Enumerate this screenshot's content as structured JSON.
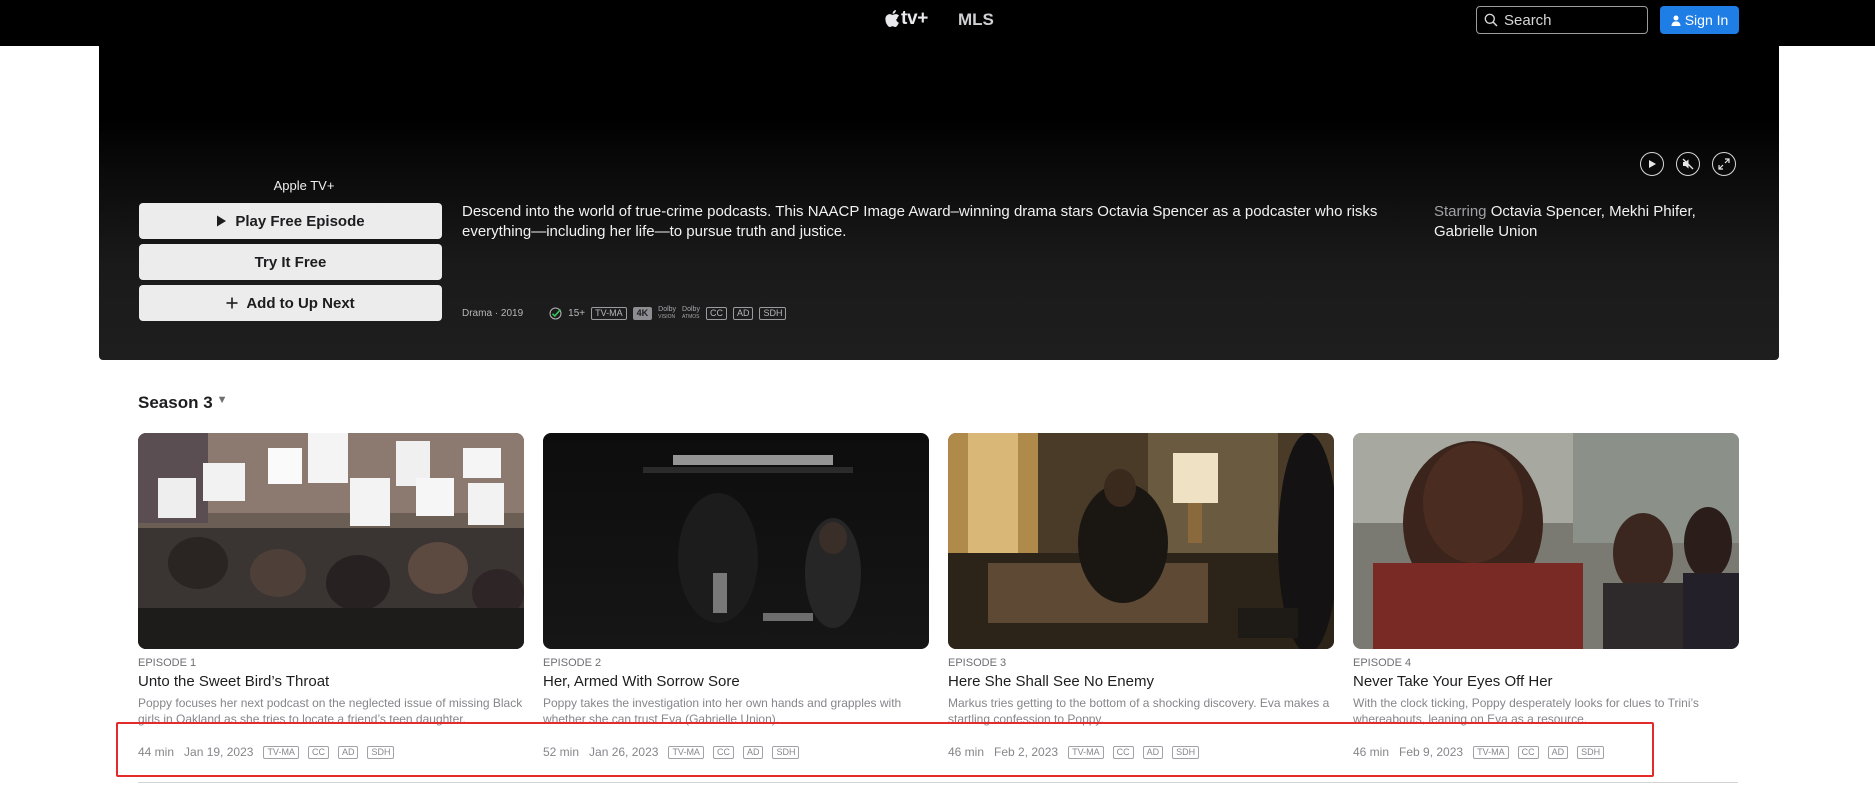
{
  "nav": {
    "brand": "tv+",
    "mls": "MLS",
    "search_placeholder": "Search",
    "signin_label": "Sign In"
  },
  "hero": {
    "provider": "Apple TV+",
    "play_label": "Play Free Episode",
    "try_label": "Try It Free",
    "upnext_label": "Add to Up Next",
    "description": "Descend into the world of true-crime podcasts. This NAACP Image Award–winning drama stars Octavia Spencer as a podcaster who risks everything—including her life—to pursue truth and justice.",
    "starring_label": "Starring",
    "starring_names": "Octavia Spencer, Mekhi Phifer, Gabrielle Union",
    "genre_year": "Drama · 2019",
    "age_rating": "15+",
    "badges": [
      "TV-MA",
      "4K",
      "CC",
      "AD",
      "SDH"
    ],
    "dolby_vision": [
      "Dolby",
      "VISION"
    ],
    "dolby_atmos": [
      "Dolby",
      "ATMOS"
    ],
    "controls": [
      "play-icon",
      "mute-icon",
      "fullscreen-icon"
    ]
  },
  "season": {
    "label": "Season 3"
  },
  "episodes": [
    {
      "num": "EPISODE 1",
      "title": "Unto the Sweet Bird’s Throat",
      "desc": "Poppy focuses her next podcast on the neglected issue of missing Black girls in Oakland as she tries to locate a friend’s teen daughter.",
      "duration": "44 min",
      "date": "Jan 19, 2023",
      "badges": [
        "TV-MA",
        "CC",
        "AD",
        "SDH"
      ]
    },
    {
      "num": "EPISODE 2",
      "title": "Her, Armed With Sorrow Sore",
      "desc": "Poppy takes the investigation into her own hands and grapples with whether she can trust Eva (Gabrielle Union).",
      "duration": "52 min",
      "date": "Jan 26, 2023",
      "badges": [
        "TV-MA",
        "CC",
        "AD",
        "SDH"
      ]
    },
    {
      "num": "EPISODE 3",
      "title": "Here She Shall See No Enemy",
      "desc": "Markus tries getting to the bottom of a shocking discovery. Eva makes a startling confession to Poppy.",
      "duration": "46 min",
      "date": "Feb 2, 2023",
      "badges": [
        "TV-MA",
        "CC",
        "AD",
        "SDH"
      ]
    },
    {
      "num": "EPISODE 4",
      "title": "Never Take Your Eyes Off Her",
      "desc": "With the clock ticking, Poppy desperately looks for clues to Trini’s whereabouts, leaning on Eva as a resource.",
      "duration": "46 min",
      "date": "Feb 9, 2023",
      "badges": [
        "TV-MA",
        "CC",
        "AD",
        "SDH"
      ]
    }
  ],
  "colors": {
    "accent": "#1f7de6",
    "highlight": "#e32b2b"
  }
}
